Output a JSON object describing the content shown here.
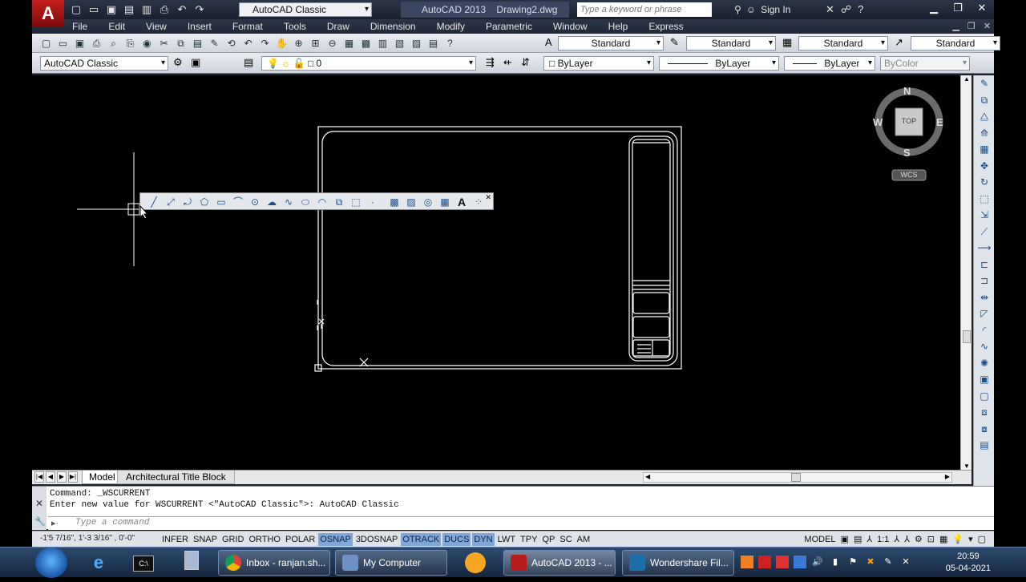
{
  "titlebar": {
    "workspace": "AutoCAD Classic",
    "app_name": "AutoCAD 2013",
    "drawing_name": "Drawing2.dwg",
    "search_placeholder": "Type a keyword or phrase",
    "sign_in": "Sign In"
  },
  "menu": [
    "File",
    "Edit",
    "View",
    "Insert",
    "Format",
    "Tools",
    "Draw",
    "Dimension",
    "Modify",
    "Parametric",
    "Window",
    "Help",
    "Express"
  ],
  "styles_toolbar": {
    "text_style": "Standard",
    "dim_style": "Standard",
    "table_style": "Standard",
    "mleader_style": "Standard"
  },
  "layers_toolbar": {
    "workspace": "AutoCAD Classic",
    "layer": "0",
    "color": "ByLayer",
    "linetype": "ByLayer",
    "lineweight": "ByLayer",
    "plotstyle": "ByColor"
  },
  "viewcube": {
    "north": "N",
    "south": "S",
    "east": "E",
    "west": "W",
    "face": "TOP",
    "ucs": "WCS"
  },
  "tabs": {
    "model": "Model",
    "layout": "Architectural Title Block"
  },
  "command": {
    "line1": "Command:  _WSCURRENT",
    "line2": "Enter new value for WSCURRENT <\"AutoCAD Classic\">: AutoCAD Classic",
    "placeholder": "Type a command"
  },
  "status": {
    "coordinates": "-1'5 7/16\", 1'-3 3/16\" , 0'-0\"",
    "toggles": [
      {
        "label": "INFER",
        "on": false
      },
      {
        "label": "SNAP",
        "on": false
      },
      {
        "label": "GRID",
        "on": false
      },
      {
        "label": "ORTHO",
        "on": false
      },
      {
        "label": "POLAR",
        "on": false
      },
      {
        "label": "OSNAP",
        "on": true
      },
      {
        "label": "3DOSNAP",
        "on": false
      },
      {
        "label": "OTRACK",
        "on": true
      },
      {
        "label": "DUCS",
        "on": true
      },
      {
        "label": "DYN",
        "on": true
      },
      {
        "label": "LWT",
        "on": false
      },
      {
        "label": "TPY",
        "on": false
      },
      {
        "label": "QP",
        "on": false
      },
      {
        "label": "SC",
        "on": false
      },
      {
        "label": "AM",
        "on": false
      }
    ],
    "space": "MODEL",
    "scale": "1:1"
  },
  "taskbar": {
    "chrome": "Inbox - ranjan.sh...",
    "mycomputer": "My Computer",
    "autocad": "AutoCAD 2013 - ...",
    "wondershare": "Wondershare Fil...",
    "time": "20:59",
    "date": "05-04-2021"
  }
}
